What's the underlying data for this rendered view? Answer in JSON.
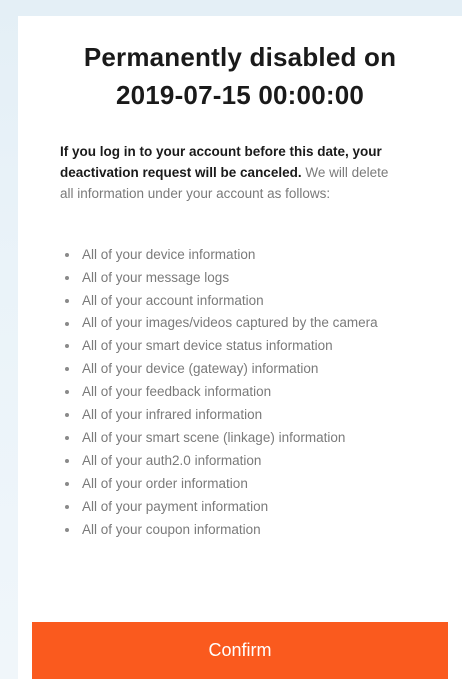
{
  "dialog": {
    "title_line1": "Permanently disabled on",
    "title_line2": "2019-07-15 00:00:00",
    "notice_bold": "If you log in to your account before this date, your deactivation request will be canceled.",
    "notice_rest": "We will delete all information under your account as follows:",
    "items": [
      "All of your device information",
      "All of your message logs",
      "All of your account information",
      "All of your images/videos captured by the camera",
      "All of your smart device status information",
      "All of your device (gateway) information",
      "All of your feedback information",
      "All of your infrared information",
      "All of your smart scene (linkage) information",
      "All of your auth2.0 information",
      "All of your order information",
      "All of your payment information",
      "All of your coupon information"
    ],
    "confirm_label": "Confirm"
  },
  "colors": {
    "accent": "#fa5a1e",
    "title": "#1a1a1a",
    "body_text": "#7a7a7a",
    "background": "#e4eff6"
  }
}
